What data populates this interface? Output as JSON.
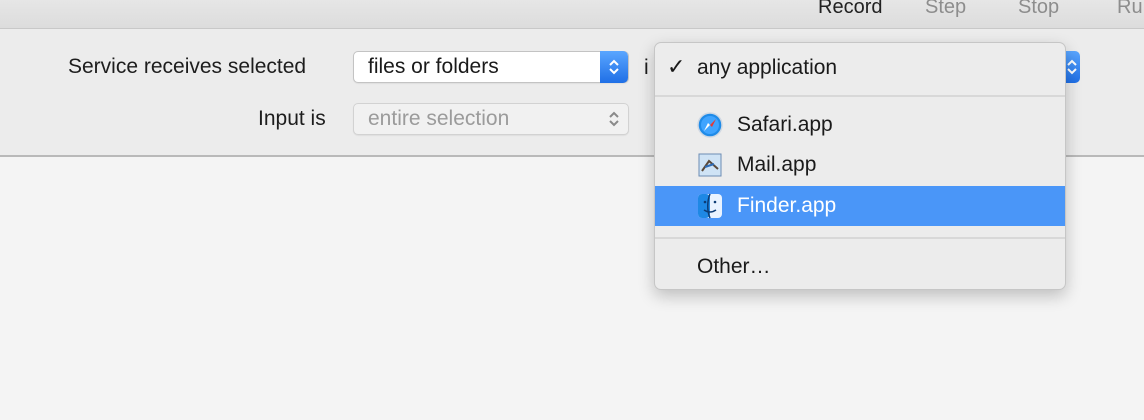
{
  "toolbar": {
    "buttons": [
      {
        "label": "Record",
        "state": "enabled"
      },
      {
        "label": "Step",
        "state": "disabled"
      },
      {
        "label": "Stop",
        "state": "disabled"
      },
      {
        "label": "Ru",
        "state": "disabled"
      }
    ]
  },
  "service": {
    "receives_label": "Service receives selected",
    "receives_value": "files or folders",
    "in_label_partial": "i",
    "input_label": "Input is",
    "input_value": "entire selection"
  },
  "app_menu": {
    "checked_item": "any application",
    "items": [
      {
        "label": "Safari.app",
        "icon": "safari-icon"
      },
      {
        "label": "Mail.app",
        "icon": "mail-icon"
      },
      {
        "label": "Finder.app",
        "icon": "finder-icon",
        "highlighted": true
      }
    ],
    "other_label": "Other…"
  },
  "colors": {
    "accent": "#4a96f8",
    "stepper_blue": "#1f6fe6"
  }
}
